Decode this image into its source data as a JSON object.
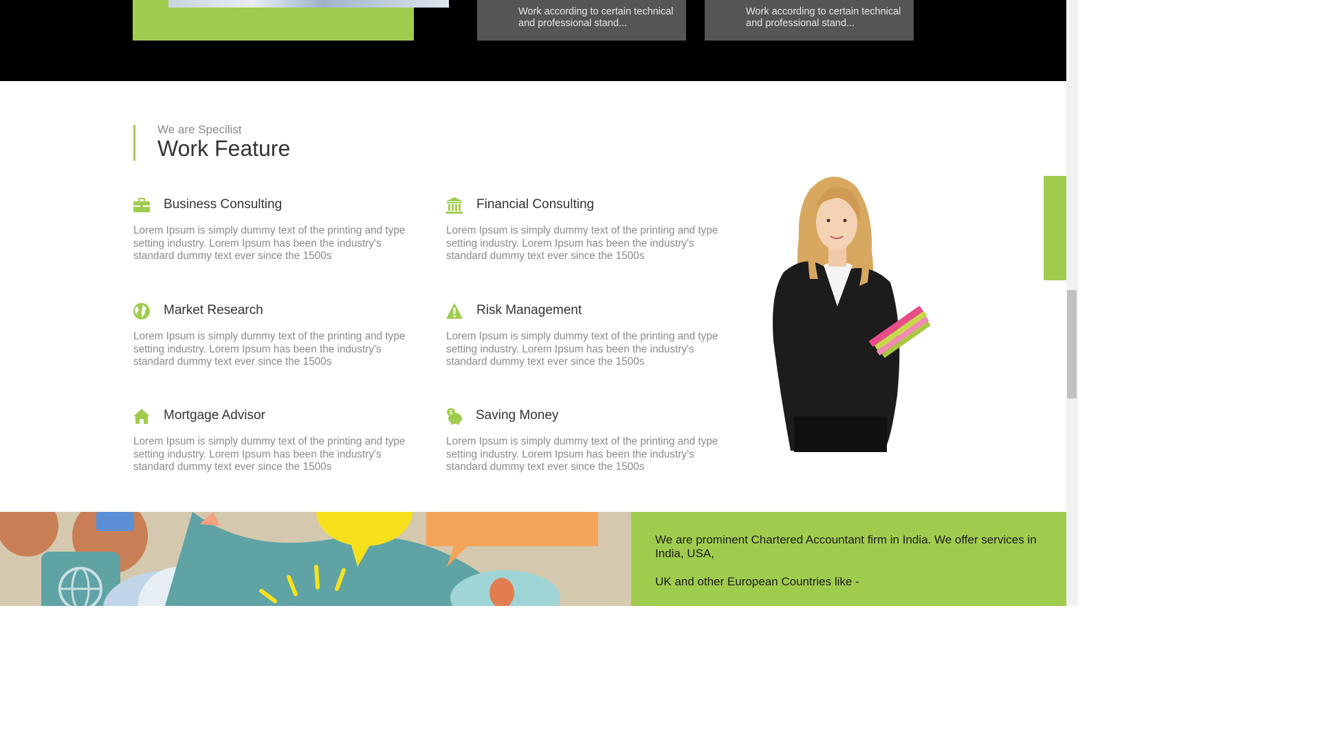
{
  "top_cards": [
    {
      "text": "Work according to certain technical and professional stand..."
    },
    {
      "text": "Work according to certain technical and professional stand..."
    }
  ],
  "section": {
    "subtitle": "We are Specilist",
    "title": "Work Feature"
  },
  "features": [
    {
      "icon": "briefcase-icon",
      "title": "Business Consulting",
      "text": "Lorem Ipsum is simply dummy text of the printing and type setting industry. Lorem Ipsum has been the industry's standard dummy text ever since the 1500s"
    },
    {
      "icon": "bank-icon",
      "title": "Financial Consulting",
      "text": "Lorem Ipsum is simply dummy text of the printing and type setting industry. Lorem Ipsum has been the industry's standard dummy text ever since the 1500s"
    },
    {
      "icon": "globe-icon",
      "title": "Market Research",
      "text": "Lorem Ipsum is simply dummy text of the printing and type setting industry. Lorem Ipsum has been the industry's standard dummy text ever since the 1500s"
    },
    {
      "icon": "warning-icon",
      "title": "Risk Management",
      "text": "Lorem Ipsum is simply dummy text of the printing and type setting industry. Lorem Ipsum has been the industry's standard dummy text ever since the 1500s"
    },
    {
      "icon": "home-icon",
      "title": "Mortgage Advisor",
      "text": "Lorem Ipsum is simply dummy text of the printing and type setting industry. Lorem Ipsum has been the industry's standard dummy text ever since the 1500s"
    },
    {
      "icon": "piggy-bank-icon",
      "title": "Saving Money",
      "text": "Lorem Ipsum is simply dummy text of the printing and type setting industry. Lorem Ipsum has been the industry's standard dummy text ever since the 1500s"
    }
  ],
  "about": {
    "line1": "We are prominent Chartered Accountant firm in India. We offer services in India, USA,",
    "line2": "UK and other European Countries like -"
  },
  "colors": {
    "accent": "#a0cc4e",
    "dark_band": "#000000",
    "card_grey": "#555555"
  }
}
